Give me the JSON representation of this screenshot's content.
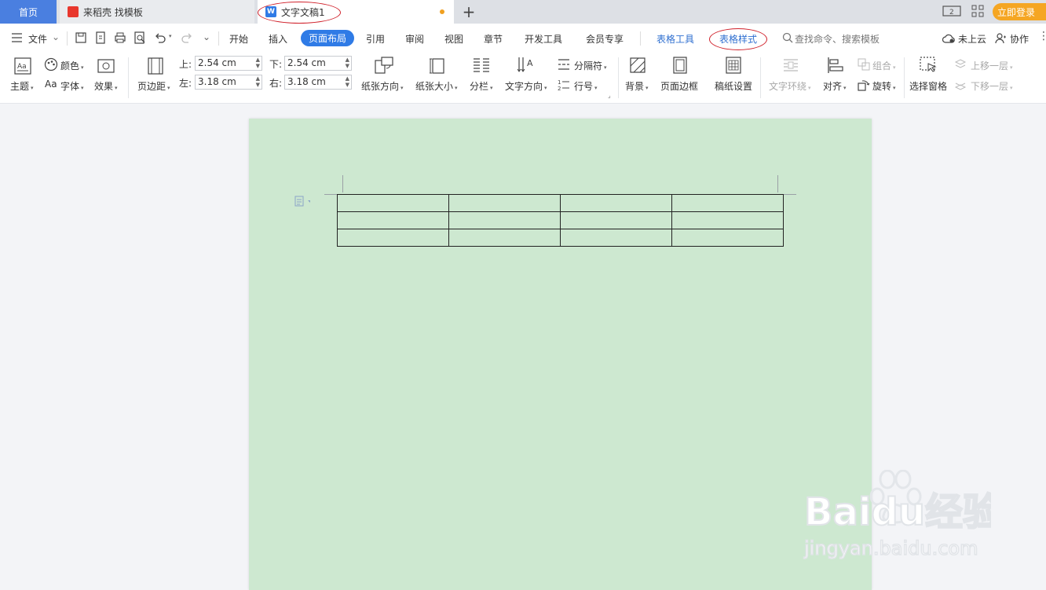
{
  "tabs": {
    "home": "首页",
    "daoke": "来稻壳 找模板",
    "document": "文字文稿1"
  },
  "login_label": "立即登录",
  "menu": {
    "file": "文件",
    "items": [
      "开始",
      "插入",
      "页面布局",
      "引用",
      "审阅",
      "视图",
      "章节",
      "开发工具",
      "会员专享"
    ],
    "active": "页面布局",
    "table_tools": "表格工具",
    "table_style": "表格样式",
    "search": "查找命令、搜索模板",
    "cloud": "未上云",
    "collab": "协作"
  },
  "ribbon": {
    "theme": "主题",
    "color": "颜色",
    "font": "字体",
    "effect": "效果",
    "margins": "页边距",
    "margin_top_label": "上:",
    "margin_top": "2.54 cm",
    "margin_bottom_label": "下:",
    "margin_bottom": "2.54 cm",
    "margin_left_label": "左:",
    "margin_left": "3.18 cm",
    "margin_right_label": "右:",
    "margin_right": "3.18 cm",
    "orientation": "纸张方向",
    "paper_size": "纸张大小",
    "columns": "分栏",
    "text_direction": "文字方向",
    "separator": "分隔符",
    "line_numbers": "行号",
    "background": "背景",
    "page_border": "页面边框",
    "manuscript": "稿纸设置",
    "text_wrap": "文字环绕",
    "align": "对齐",
    "rotate": "旋转",
    "group": "组合",
    "selection_pane": "选择窗格",
    "bring_forward": "上移一层",
    "send_backward": "下移一层"
  },
  "watermark": {
    "brand": "Baidu经验",
    "url": "jingyan.baidu.com"
  },
  "colors": {
    "accent": "#2f7be6",
    "page_background": "#cde8d0",
    "annotation": "#d0202a",
    "login": "#f5a623"
  }
}
